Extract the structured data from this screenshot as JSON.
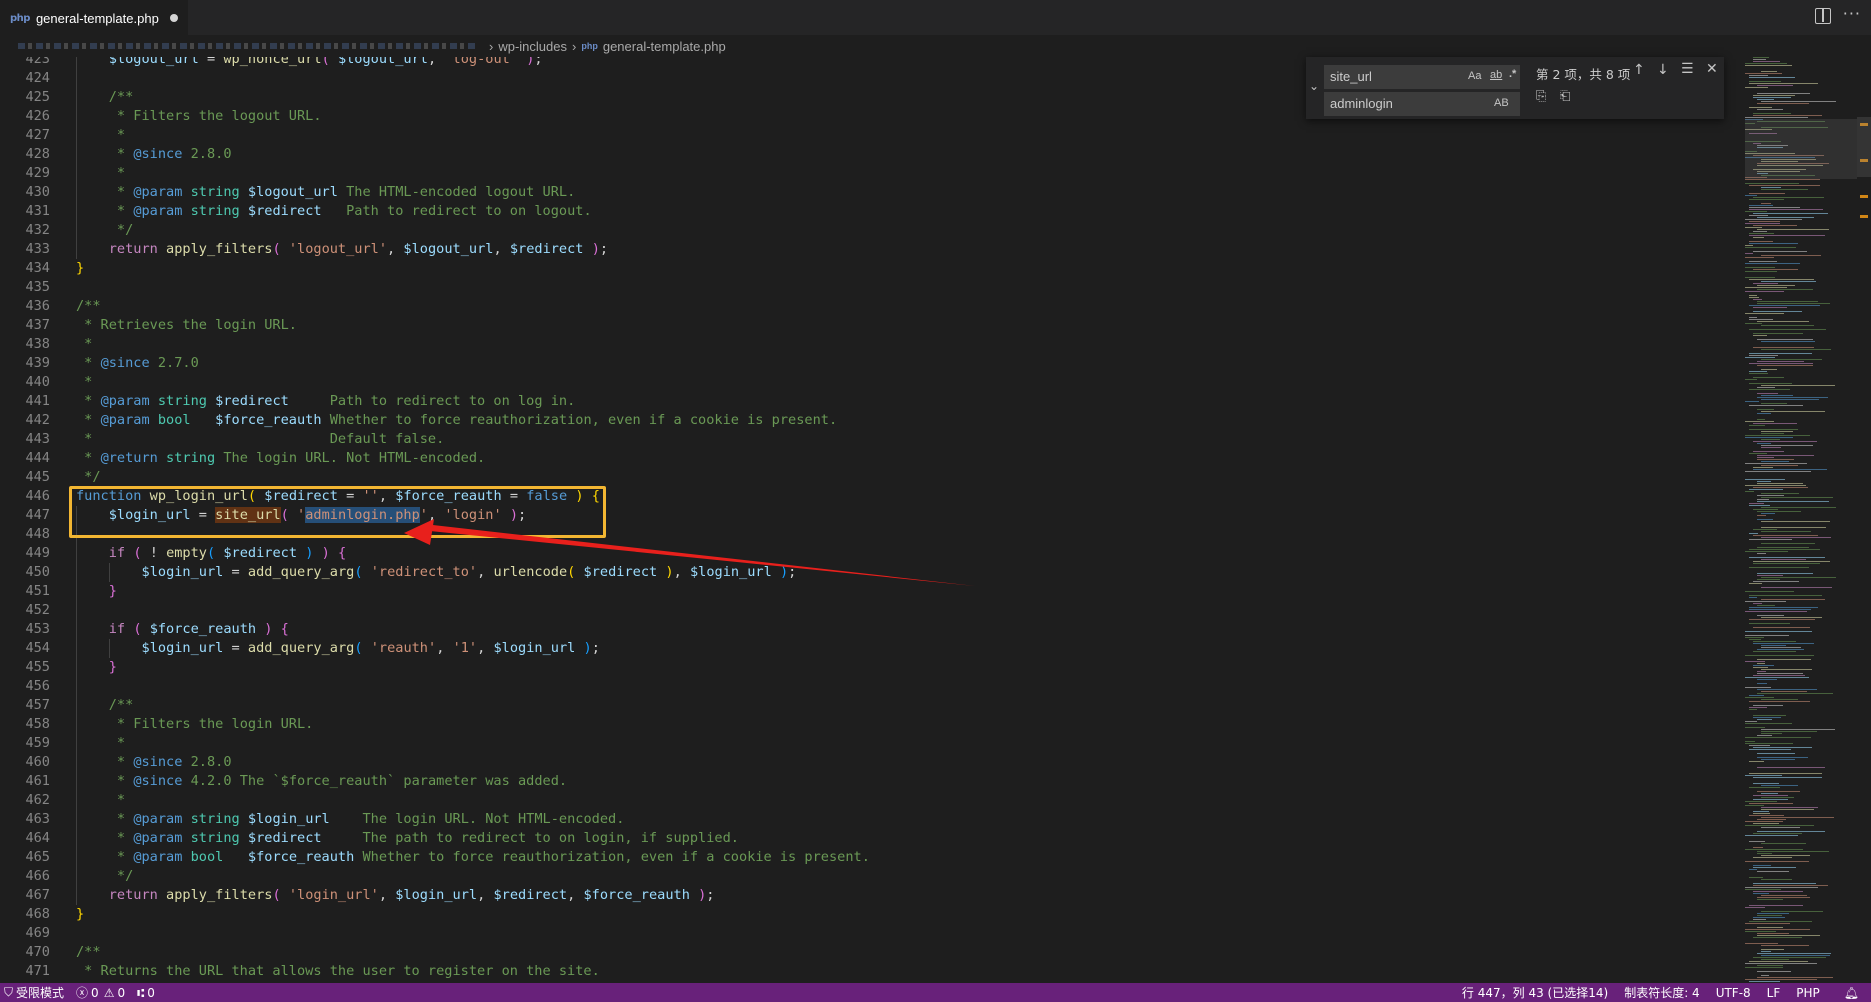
{
  "tab": {
    "icon": "php",
    "title": "general-template.php"
  },
  "breadcrumb": {
    "folder": "wp-includes",
    "file_icon": "php",
    "file": "general-template.php"
  },
  "find": {
    "search_value": "site_url",
    "replace_value": "adminlogin",
    "match_case": "Aa",
    "match_word": "ab",
    "regex": ".*",
    "preserve_case": "AB",
    "count": "第 2 项，共 8 项"
  },
  "status": {
    "restricted": "受限模式",
    "errors": "0",
    "warnings": "0",
    "ports": "0",
    "position": "行 447，列 43 (已选择14)",
    "indent": "制表符长度: 4",
    "encoding": "UTF-8",
    "eol": "LF",
    "language": "PHP"
  },
  "code_lines": [
    {
      "n": "423",
      "i": 1,
      "s": [
        [
          "$logout_url",
          "var"
        ],
        [
          " = ",
          ""
        ],
        [
          "wp_nonce_url",
          "fn"
        ],
        [
          "( ",
          "br2"
        ],
        [
          "$logout_url",
          "var"
        ],
        [
          ", ",
          ""
        ],
        [
          "'log-out'",
          "str"
        ],
        [
          " ",
          ""
        ],
        [
          ")",
          "br2"
        ],
        [
          ";",
          ""
        ]
      ]
    },
    {
      "n": "424",
      "i": 1,
      "s": []
    },
    {
      "n": "425",
      "i": 1,
      "s": [
        [
          "/**",
          "cmt"
        ]
      ]
    },
    {
      "n": "426",
      "i": 1,
      "s": [
        [
          " * Filters the logout URL.",
          "cmt"
        ]
      ]
    },
    {
      "n": "427",
      "i": 1,
      "s": [
        [
          " *",
          "cmt"
        ]
      ]
    },
    {
      "n": "428",
      "i": 1,
      "s": [
        [
          " * ",
          "cmt"
        ],
        [
          "@since",
          "tag"
        ],
        [
          " 2.8.0",
          "cmt"
        ]
      ]
    },
    {
      "n": "429",
      "i": 1,
      "s": [
        [
          " *",
          "cmt"
        ]
      ]
    },
    {
      "n": "430",
      "i": 1,
      "s": [
        [
          " * ",
          "cmt"
        ],
        [
          "@param",
          "tag"
        ],
        [
          " string",
          "type"
        ],
        [
          " $logout_url",
          "var"
        ],
        [
          " The HTML-encoded logout URL.",
          "cmt"
        ]
      ]
    },
    {
      "n": "431",
      "i": 1,
      "s": [
        [
          " * ",
          "cmt"
        ],
        [
          "@param",
          "tag"
        ],
        [
          " string",
          "type"
        ],
        [
          " $redirect",
          "var"
        ],
        [
          "   Path to redirect to on logout.",
          "cmt"
        ]
      ]
    },
    {
      "n": "432",
      "i": 1,
      "s": [
        [
          " */",
          "cmt"
        ]
      ]
    },
    {
      "n": "433",
      "i": 1,
      "s": [
        [
          "return",
          "ctl"
        ],
        [
          " ",
          ""
        ],
        [
          "apply_filters",
          "fn"
        ],
        [
          "( ",
          "br2"
        ],
        [
          "'logout_url'",
          "str"
        ],
        [
          ", ",
          ""
        ],
        [
          "$logout_url",
          "var"
        ],
        [
          ", ",
          ""
        ],
        [
          "$redirect",
          "var"
        ],
        [
          " ",
          ""
        ],
        [
          ")",
          "br2"
        ],
        [
          ";",
          ""
        ]
      ]
    },
    {
      "n": "434",
      "i": 0,
      "s": [
        [
          "}",
          "br1"
        ]
      ]
    },
    {
      "n": "435",
      "i": 0,
      "s": []
    },
    {
      "n": "436",
      "i": 0,
      "s": [
        [
          "/**",
          "cmt"
        ]
      ]
    },
    {
      "n": "437",
      "i": 0,
      "s": [
        [
          " * Retrieves the login URL.",
          "cmt"
        ]
      ]
    },
    {
      "n": "438",
      "i": 0,
      "s": [
        [
          " *",
          "cmt"
        ]
      ]
    },
    {
      "n": "439",
      "i": 0,
      "s": [
        [
          " * ",
          "cmt"
        ],
        [
          "@since",
          "tag"
        ],
        [
          " 2.7.0",
          "cmt"
        ]
      ]
    },
    {
      "n": "440",
      "i": 0,
      "s": [
        [
          " *",
          "cmt"
        ]
      ]
    },
    {
      "n": "441",
      "i": 0,
      "s": [
        [
          " * ",
          "cmt"
        ],
        [
          "@param",
          "tag"
        ],
        [
          " string",
          "type"
        ],
        [
          " $redirect",
          "var"
        ],
        [
          "     Path to redirect to on log in.",
          "cmt"
        ]
      ]
    },
    {
      "n": "442",
      "i": 0,
      "s": [
        [
          " * ",
          "cmt"
        ],
        [
          "@param",
          "tag"
        ],
        [
          " bool",
          "type"
        ],
        [
          "   $force_reauth",
          "var"
        ],
        [
          " Whether to force reauthorization, even if a cookie is present.",
          "cmt"
        ]
      ]
    },
    {
      "n": "443",
      "i": 0,
      "s": [
        [
          " *                             Default false.",
          "cmt"
        ]
      ]
    },
    {
      "n": "444",
      "i": 0,
      "s": [
        [
          " * ",
          "cmt"
        ],
        [
          "@return",
          "tag"
        ],
        [
          " string",
          "type"
        ],
        [
          " The login URL. Not HTML-encoded.",
          "cmt"
        ]
      ]
    },
    {
      "n": "445",
      "i": 0,
      "s": [
        [
          " */",
          "cmt"
        ]
      ]
    },
    {
      "n": "446",
      "i": 0,
      "s": [
        [
          "function",
          "kw"
        ],
        [
          " ",
          ""
        ],
        [
          "wp_login_url",
          "fn"
        ],
        [
          "( ",
          "br1"
        ],
        [
          "$redirect",
          "var"
        ],
        [
          " = ",
          ""
        ],
        [
          "''",
          "str"
        ],
        [
          ", ",
          ""
        ],
        [
          "$force_reauth",
          "var"
        ],
        [
          " = ",
          ""
        ],
        [
          "false",
          "kw"
        ],
        [
          " ",
          ""
        ],
        [
          ")",
          "br1"
        ],
        [
          " ",
          ""
        ],
        [
          "{",
          "br1"
        ]
      ]
    },
    {
      "n": "447",
      "i": 1,
      "s": [
        [
          "$login_url",
          "var"
        ],
        [
          " = ",
          ""
        ],
        [
          "site_url",
          "fn match"
        ],
        [
          "( ",
          "br2"
        ],
        [
          "'",
          "str"
        ],
        [
          "adminlogin.php",
          "str sel"
        ],
        [
          "'",
          "str"
        ],
        [
          ", ",
          ""
        ],
        [
          "'login'",
          "str"
        ],
        [
          " ",
          ""
        ],
        [
          ")",
          "br2"
        ],
        [
          ";",
          ""
        ]
      ]
    },
    {
      "n": "448",
      "i": 1,
      "s": []
    },
    {
      "n": "449",
      "i": 1,
      "s": [
        [
          "if",
          "ctl"
        ],
        [
          " ",
          ""
        ],
        [
          "( ",
          "br2"
        ],
        [
          "! ",
          ""
        ],
        [
          "empty",
          "fn"
        ],
        [
          "( ",
          "br3"
        ],
        [
          "$redirect",
          "var"
        ],
        [
          " ",
          ""
        ],
        [
          ")",
          "br3"
        ],
        [
          " ",
          ""
        ],
        [
          ")",
          "br2"
        ],
        [
          " ",
          ""
        ],
        [
          "{",
          "br2"
        ]
      ]
    },
    {
      "n": "450",
      "i": 2,
      "s": [
        [
          "$login_url",
          "var"
        ],
        [
          " = ",
          ""
        ],
        [
          "add_query_arg",
          "fn"
        ],
        [
          "( ",
          "br3"
        ],
        [
          "'redirect_to'",
          "str"
        ],
        [
          ", ",
          ""
        ],
        [
          "urlencode",
          "fn"
        ],
        [
          "( ",
          "br1"
        ],
        [
          "$redirect",
          "var"
        ],
        [
          " ",
          ""
        ],
        [
          ")",
          "br1"
        ],
        [
          ", ",
          ""
        ],
        [
          "$login_url",
          "var"
        ],
        [
          " ",
          ""
        ],
        [
          ")",
          "br3"
        ],
        [
          ";",
          ""
        ]
      ]
    },
    {
      "n": "451",
      "i": 1,
      "s": [
        [
          "}",
          "br2"
        ]
      ]
    },
    {
      "n": "452",
      "i": 1,
      "s": []
    },
    {
      "n": "453",
      "i": 1,
      "s": [
        [
          "if",
          "ctl"
        ],
        [
          " ",
          ""
        ],
        [
          "( ",
          "br2"
        ],
        [
          "$force_reauth",
          "var"
        ],
        [
          " ",
          ""
        ],
        [
          ")",
          "br2"
        ],
        [
          " ",
          ""
        ],
        [
          "{",
          "br2"
        ]
      ]
    },
    {
      "n": "454",
      "i": 2,
      "s": [
        [
          "$login_url",
          "var"
        ],
        [
          " = ",
          ""
        ],
        [
          "add_query_arg",
          "fn"
        ],
        [
          "( ",
          "br3"
        ],
        [
          "'reauth'",
          "str"
        ],
        [
          ", ",
          ""
        ],
        [
          "'1'",
          "str"
        ],
        [
          ", ",
          ""
        ],
        [
          "$login_url",
          "var"
        ],
        [
          " ",
          ""
        ],
        [
          ")",
          "br3"
        ],
        [
          ";",
          ""
        ]
      ]
    },
    {
      "n": "455",
      "i": 1,
      "s": [
        [
          "}",
          "br2"
        ]
      ]
    },
    {
      "n": "456",
      "i": 1,
      "s": []
    },
    {
      "n": "457",
      "i": 1,
      "s": [
        [
          "/**",
          "cmt"
        ]
      ]
    },
    {
      "n": "458",
      "i": 1,
      "s": [
        [
          " * Filters the login URL.",
          "cmt"
        ]
      ]
    },
    {
      "n": "459",
      "i": 1,
      "s": [
        [
          " *",
          "cmt"
        ]
      ]
    },
    {
      "n": "460",
      "i": 1,
      "s": [
        [
          " * ",
          "cmt"
        ],
        [
          "@since",
          "tag"
        ],
        [
          " 2.8.0",
          "cmt"
        ]
      ]
    },
    {
      "n": "461",
      "i": 1,
      "s": [
        [
          " * ",
          "cmt"
        ],
        [
          "@since",
          "tag"
        ],
        [
          " 4.2.0 The `$force_reauth` parameter was added.",
          "cmt"
        ]
      ]
    },
    {
      "n": "462",
      "i": 1,
      "s": [
        [
          " *",
          "cmt"
        ]
      ]
    },
    {
      "n": "463",
      "i": 1,
      "s": [
        [
          " * ",
          "cmt"
        ],
        [
          "@param",
          "tag"
        ],
        [
          " string",
          "type"
        ],
        [
          " $login_url",
          "var"
        ],
        [
          "    The login URL. Not HTML-encoded.",
          "cmt"
        ]
      ]
    },
    {
      "n": "464",
      "i": 1,
      "s": [
        [
          " * ",
          "cmt"
        ],
        [
          "@param",
          "tag"
        ],
        [
          " string",
          "type"
        ],
        [
          " $redirect",
          "var"
        ],
        [
          "     The path to redirect to on login, if supplied.",
          "cmt"
        ]
      ]
    },
    {
      "n": "465",
      "i": 1,
      "s": [
        [
          " * ",
          "cmt"
        ],
        [
          "@param",
          "tag"
        ],
        [
          " bool",
          "type"
        ],
        [
          "   $force_reauth",
          "var"
        ],
        [
          " Whether to force reauthorization, even if a cookie is present.",
          "cmt"
        ]
      ]
    },
    {
      "n": "466",
      "i": 1,
      "s": [
        [
          " */",
          "cmt"
        ]
      ]
    },
    {
      "n": "467",
      "i": 1,
      "s": [
        [
          "return",
          "ctl"
        ],
        [
          " ",
          ""
        ],
        [
          "apply_filters",
          "fn"
        ],
        [
          "( ",
          "br2"
        ],
        [
          "'login_url'",
          "str"
        ],
        [
          ", ",
          ""
        ],
        [
          "$login_url",
          "var"
        ],
        [
          ", ",
          ""
        ],
        [
          "$redirect",
          "var"
        ],
        [
          ", ",
          ""
        ],
        [
          "$force_reauth",
          "var"
        ],
        [
          " ",
          ""
        ],
        [
          ")",
          "br2"
        ],
        [
          ";",
          ""
        ]
      ]
    },
    {
      "n": "468",
      "i": 0,
      "s": [
        [
          "}",
          "br1"
        ]
      ]
    },
    {
      "n": "469",
      "i": 0,
      "s": []
    },
    {
      "n": "470",
      "i": 0,
      "s": [
        [
          "/**",
          "cmt"
        ]
      ]
    },
    {
      "n": "471",
      "i": 0,
      "s": [
        [
          " * Returns the URL that allows the user to register on the site.",
          "cmt"
        ]
      ]
    }
  ],
  "colors": {
    "highlight_box": "#f2b632",
    "arrow": "#e8201c",
    "status_bar": "#68217a"
  }
}
